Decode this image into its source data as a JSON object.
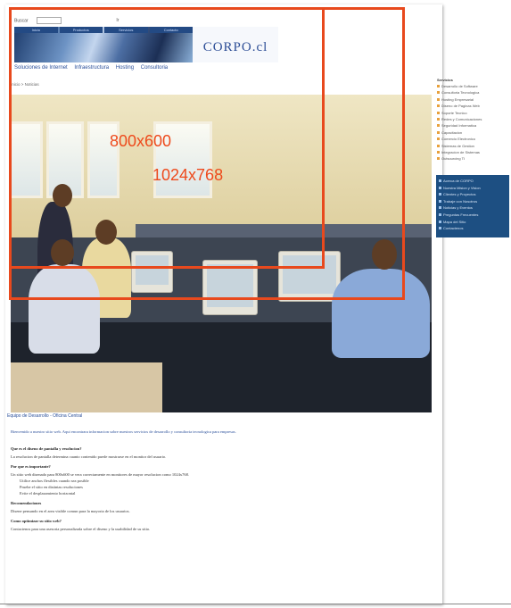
{
  "header": {
    "search_label": "Buscar",
    "go_label": "Ir",
    "logo_text": "CORPO.cl",
    "banner_tabs": [
      "Inicio",
      "Productos",
      "Servicios",
      "Contacto"
    ]
  },
  "nav": {
    "items": [
      "Soluciones de Internet",
      "Infraestructura",
      "Hosting",
      "Consultoria"
    ]
  },
  "breadcrumb": "Inicio > Noticias",
  "overlay": {
    "label_small": "800x600",
    "label_large": "1024x768",
    "color": "#e8491d"
  },
  "caption": "Equipo de Desarrollo - Oficina Central",
  "sidebar": {
    "title": "Servicios",
    "items": [
      "Desarrollo de Software",
      "Consultoria Tecnologica",
      "Hosting Empresarial",
      "Diseno de Paginas Web",
      "Soporte Tecnico",
      "Redes y Comunicaciones",
      "Seguridad Informatica",
      "Capacitacion",
      "Comercio Electronico",
      "Sistemas de Gestion",
      "Integracion de Sistemas",
      "Outsourcing TI"
    ],
    "panel_items": [
      "Acerca de CORPO",
      "Nuestra Mision y Vision",
      "Clientes y Proyectos",
      "Trabaje con Nosotros",
      "Noticias y Eventos",
      "Preguntas Frecuentes",
      "Mapa del Sitio",
      "Contactenos"
    ]
  },
  "article": {
    "lead": "Bienvenido a nuestro sitio web. Aqui encontrara informacion sobre nuestros servicios de desarrollo y consultoria tecnologica para empresas.",
    "sections": [
      {
        "heading": "Que es el diseno de pantalla y resolucion?",
        "text": "La resolucion de pantalla determina cuanto contenido puede mostrarse en el monitor del usuario."
      },
      {
        "heading": "Por que es importante?",
        "text": "Un sitio web disenado para 800x600 se vera correctamente en monitores de mayor resolucion como 1024x768."
      },
      {
        "heading": "Recomendaciones",
        "text": "Disene pensando en el area visible comun para la mayoria de los usuarios."
      }
    ],
    "list_items": [
      "Utilice anchos flexibles cuando sea posible",
      "Pruebe el sitio en distintas resoluciones",
      "Evite el desplazamiento horizontal"
    ],
    "closing_heading": "Como optimizar su sitio web?",
    "closing_text": "Contactenos para una asesoria personalizada sobre el diseno y la usabilidad de su sitio."
  }
}
